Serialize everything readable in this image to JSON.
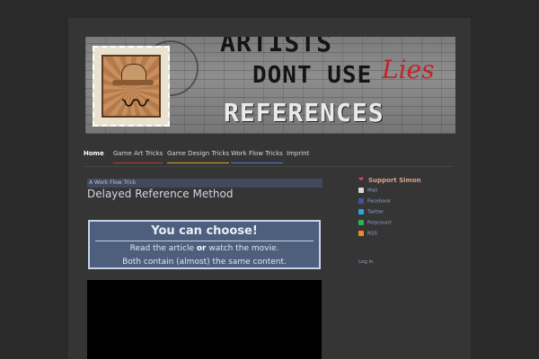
{
  "header": {
    "banner_line1": "ARTISTS",
    "banner_line2": "DONT USE",
    "banner_line3": "REFERENCES",
    "banner_scribble": "Lies"
  },
  "nav": {
    "items": [
      {
        "label": "Home"
      },
      {
        "label": "Game Art Tricks"
      },
      {
        "label": "Game Design Tricks"
      },
      {
        "label": "Work Flow Tricks"
      },
      {
        "label": "Imprint"
      }
    ]
  },
  "post": {
    "category": "A Work Flow Trick",
    "title": "Delayed Reference Method",
    "choose_box": {
      "heading": "You can choose!",
      "line1_pre": "Read the article",
      "line1_or": "or",
      "line1_post": "watch the movie.",
      "line2": "Both contain (almost) the same content."
    }
  },
  "sidebar": {
    "support_title": "Support Simon",
    "links": [
      {
        "label": "Mail",
        "icon": "mail-icon"
      },
      {
        "label": "Facebook",
        "icon": "facebook-icon"
      },
      {
        "label": "Twitter",
        "icon": "twitter-icon"
      },
      {
        "label": "Polycount",
        "icon": "polycount-icon"
      },
      {
        "label": "RSS",
        "icon": "rss-icon"
      }
    ],
    "login": "Log in"
  },
  "colors": {
    "background": "#2a2a2a",
    "panel": "#353535",
    "accent_blue": "#4d5f7d",
    "link": "#8ea4c7"
  }
}
